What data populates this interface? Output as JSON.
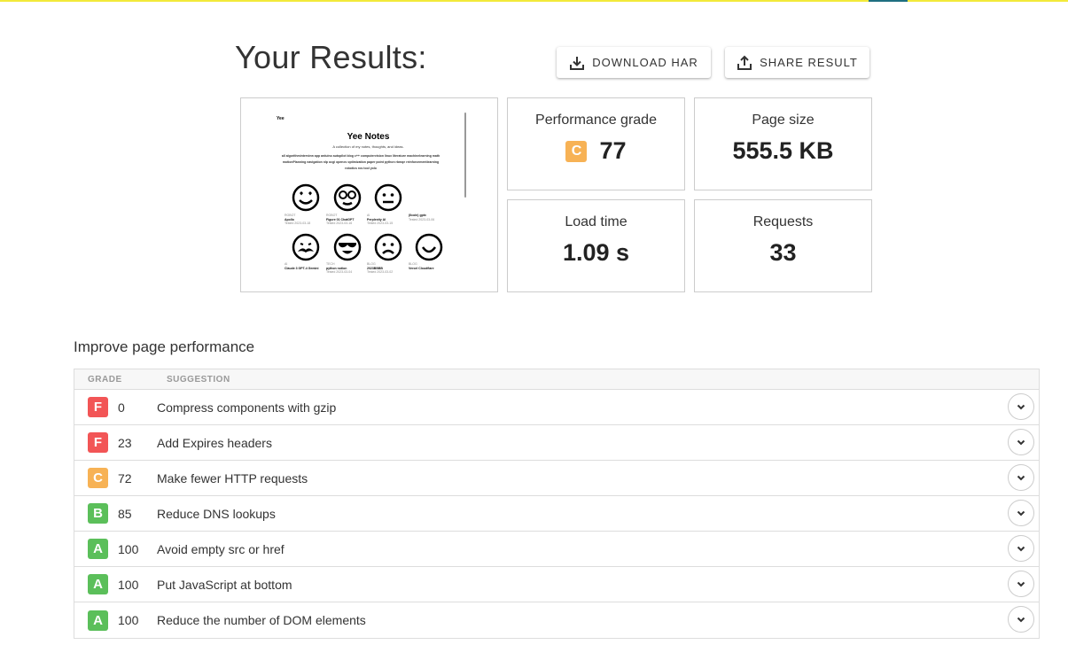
{
  "header": {
    "title": "Your Results:",
    "download_label": "DOWNLOAD HAR",
    "share_label": "SHARE RESULT"
  },
  "preview": {
    "brand": "Yee",
    "title": "Yee Notes",
    "subtitle": "A collection of my notes, thoughts, and ideas.",
    "tags": "all  algorithminterview  app  arduino  autopilot  blog  c++  computervision  linux  literature  machinelearning  math  motionPlanning  navigation  nlp  ocgi  opencv  optimization  paper  point  python  rbmqe  reinforcementlearning  robotics  ros  tool  yolo",
    "cards": [
      {
        "cat": "ROBOT",
        "title": "Apollo",
        "date": "Tested 2023-03-18"
      },
      {
        "cat": "ROBOT",
        "title": "Figure 01 ChatGPT",
        "date": "Tested 2023-03-16"
      },
      {
        "cat": "AI",
        "title": "Perplexity AI",
        "date": "Tested 2023-03-15"
      },
      {
        "cat": "",
        "title": "(Ilcoin) gptx",
        "date": "Tested 2023-03-06"
      },
      {
        "cat": "AI",
        "title": "Claude 3 GPT-4 Gemini",
        "date": ""
      },
      {
        "cat": "TECH",
        "title": "python notion",
        "date": "Tested 2023-03-04"
      },
      {
        "cat": "BLOG",
        "title": "2023BBBB",
        "date": "Tested 2023-03-02"
      },
      {
        "cat": "BLOG",
        "title": "Vercel  Cloudflare",
        "date": ""
      }
    ]
  },
  "metrics": {
    "grade_label": "Performance grade",
    "grade_letter": "C",
    "grade_value": "77",
    "size_label": "Page size",
    "size_value": "555.5 KB",
    "load_label": "Load time",
    "load_value": "1.09 s",
    "requests_label": "Requests",
    "requests_value": "33"
  },
  "improve": {
    "title": "Improve page performance",
    "col_grade": "GRADE",
    "col_suggestion": "SUGGESTION",
    "rows": [
      {
        "letter": "F",
        "score": "0",
        "text": "Compress components with gzip"
      },
      {
        "letter": "F",
        "score": "23",
        "text": "Add Expires headers"
      },
      {
        "letter": "C",
        "score": "72",
        "text": "Make fewer HTTP requests"
      },
      {
        "letter": "B",
        "score": "85",
        "text": "Reduce DNS lookups"
      },
      {
        "letter": "A",
        "score": "100",
        "text": "Avoid empty src or href"
      },
      {
        "letter": "A",
        "score": "100",
        "text": "Put JavaScript at bottom"
      },
      {
        "letter": "A",
        "score": "100",
        "text": "Reduce the number of DOM elements"
      }
    ]
  },
  "colors": {
    "grade_F": "#f25556",
    "grade_C": "#f7b255",
    "grade_B": "#5bbf5a",
    "grade_A": "#5bbf5a",
    "top_accent": "#f2ea3a"
  },
  "icons": {
    "download": "download-icon",
    "share": "share-icon",
    "expand": "chevron-down-icon"
  }
}
